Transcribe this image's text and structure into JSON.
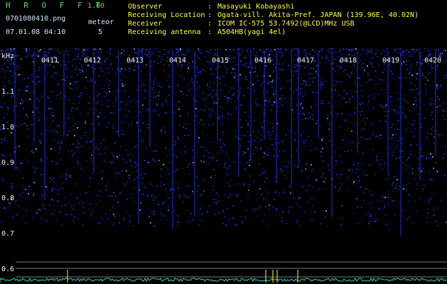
{
  "app": {
    "logo": "H R O F F T",
    "version": "1.00",
    "filename": "0701080410.png",
    "datetime": "07.01.08 04:10",
    "meteor_label": "meteor",
    "meteor_count": "5"
  },
  "info": [
    {
      "label": "Observer",
      "value": "Masayuki Kobayashi"
    },
    {
      "label": "Receiving Location",
      "value": "Ogata-vill. Akita-Pref. JAPAN (139.96E, 40.02N)"
    },
    {
      "label": "Receiver",
      "value": "ICOM IC-575 53.7492(@LCD)MHz USB"
    },
    {
      "label": "Receiving antenna",
      "value": "A504HB(yagi 4el)"
    }
  ],
  "colon": ":",
  "spectrogram": {
    "unit_label": "kHz",
    "hour_marks": [
      "0411",
      "0412",
      "0413",
      "0414",
      "0415",
      "0416",
      "0417",
      "0418",
      "0419",
      "0420"
    ],
    "freq_labels": [
      "1.1",
      "1.0",
      "0.9",
      "0.8",
      "0.7",
      "0.6"
    ],
    "colors": {
      "background": "#000000",
      "noise": "#1a2cc8",
      "bright": "#5fb8ff",
      "trace": "#2fd0c0",
      "yellow": "#ffff20"
    }
  }
}
